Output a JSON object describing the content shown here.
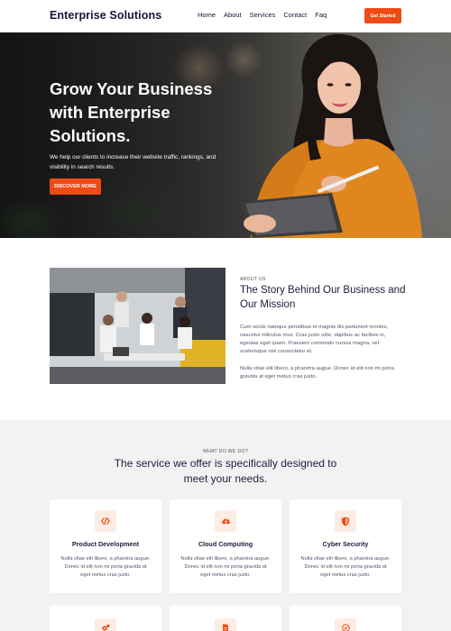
{
  "header": {
    "brand": "Enterprise Solutions",
    "nav": [
      "Home",
      "About",
      "Services",
      "Contact",
      "Faq"
    ],
    "cta": "Get Started"
  },
  "hero": {
    "title": "Grow Your Business with Enterprise Solutions.",
    "subtitle": "We help our clients to increase their website traffic, rankings, and visibility in search results.",
    "button": "DISCOVER MORE"
  },
  "about": {
    "kicker": "ABOUT US",
    "title": "The Story Behind Our Business and Our Mission",
    "paragraph1": "Cum sociis natoque penatibus et magnis dis parturient montes, nascetur ridiculus mus. Cras justo odio, dapibus ac facilisis in, egestas eget quam. Praesent commodo cursus magna, vel scelerisque nisl consectetur et.",
    "paragraph2": "Nulla vitae elit libero, a pharetra augue. Donec id elit non mi porta gravida at eget metus cras justo."
  },
  "services": {
    "kicker": "WHAT DO WE DO?",
    "title": "The service we offer is specifically designed to meet your needs.",
    "cards": [
      {
        "title": "Product Development",
        "text": "Nulla vitae elit libero, a pharetra augue. Donec id elit non mi porta gravida at eget metus cras justo.",
        "icon": "code-icon"
      },
      {
        "title": "Cloud Computing",
        "text": "Nulla vitae elit libero, a pharetra augue. Donec id elit non mi porta gravida at eget metus cras justo.",
        "icon": "cloud-upload-icon"
      },
      {
        "title": "Cyber Security",
        "text": "Nulla vitae elit libero, a pharetra augue. Donec id elit non mi porta gravida at eget metus cras justo.",
        "icon": "shield-icon"
      }
    ],
    "more_card_icons": [
      "gears-icon",
      "document-icon",
      "check-circle-icon"
    ]
  },
  "colors": {
    "accent": "#f04a15",
    "text": "#1f1d3a",
    "section_bg": "#f2f2f2"
  }
}
